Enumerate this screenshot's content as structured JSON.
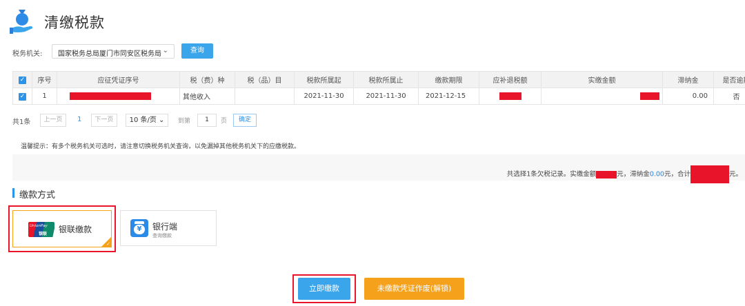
{
  "header": {
    "title": "清缴税款",
    "icon": "money-bag-hand-icon"
  },
  "filter": {
    "label": "税务机关:",
    "selected": "国家税务总局厦门市同安区税务局",
    "search_label": "查询"
  },
  "table": {
    "columns": [
      "序号",
      "应征凭证序号",
      "税（费）种",
      "税（品）目",
      "税款所属起",
      "税款所属止",
      "缴款期限",
      "应补退税额",
      "实缴金额",
      "滞纳金",
      "是否逾期"
    ],
    "rows": [
      {
        "index": "1",
        "voucher_no": "",
        "tax_type": "其他收入",
        "tax_item": "",
        "period_start": "2021-11-30",
        "period_end": "2021-11-30",
        "deadline": "2021-12-15",
        "refund_amount": "",
        "paid_amount": "",
        "late_fee": "0.00",
        "overdue": "否"
      }
    ]
  },
  "pagination": {
    "total": "共1条",
    "prev": "上一页",
    "current": "1",
    "next": "下一页",
    "page_size": "10 条/页",
    "goto_prefix": "到第",
    "goto_value": "1",
    "goto_suffix": "页",
    "confirm": "确定"
  },
  "notice": "温馨提示：有多个税务机关可选时，请注意切换税务机关查询，以免漏掉其他税务机关下的应缴税款。",
  "summary": {
    "part1": "共选择1条欠税记录。实缴金额",
    "part2": "元，滞纳金",
    "late_fee": "0.00",
    "part3": "元，合计",
    "part4": "元。"
  },
  "payment": {
    "section_title": "缴款方式",
    "methods": [
      {
        "name": "银联缴款",
        "logo_top": "UnionPay",
        "logo_bottom": "银联"
      },
      {
        "name": "银行端",
        "sub": "查询缴款"
      }
    ]
  },
  "actions": {
    "pay_now": "立即缴款",
    "void_voucher": "未缴款凭证作废(解锁)"
  },
  "colors": {
    "primary": "#3aa5ea",
    "orange": "#f5a11c",
    "highlight_red": "#e8142a"
  }
}
